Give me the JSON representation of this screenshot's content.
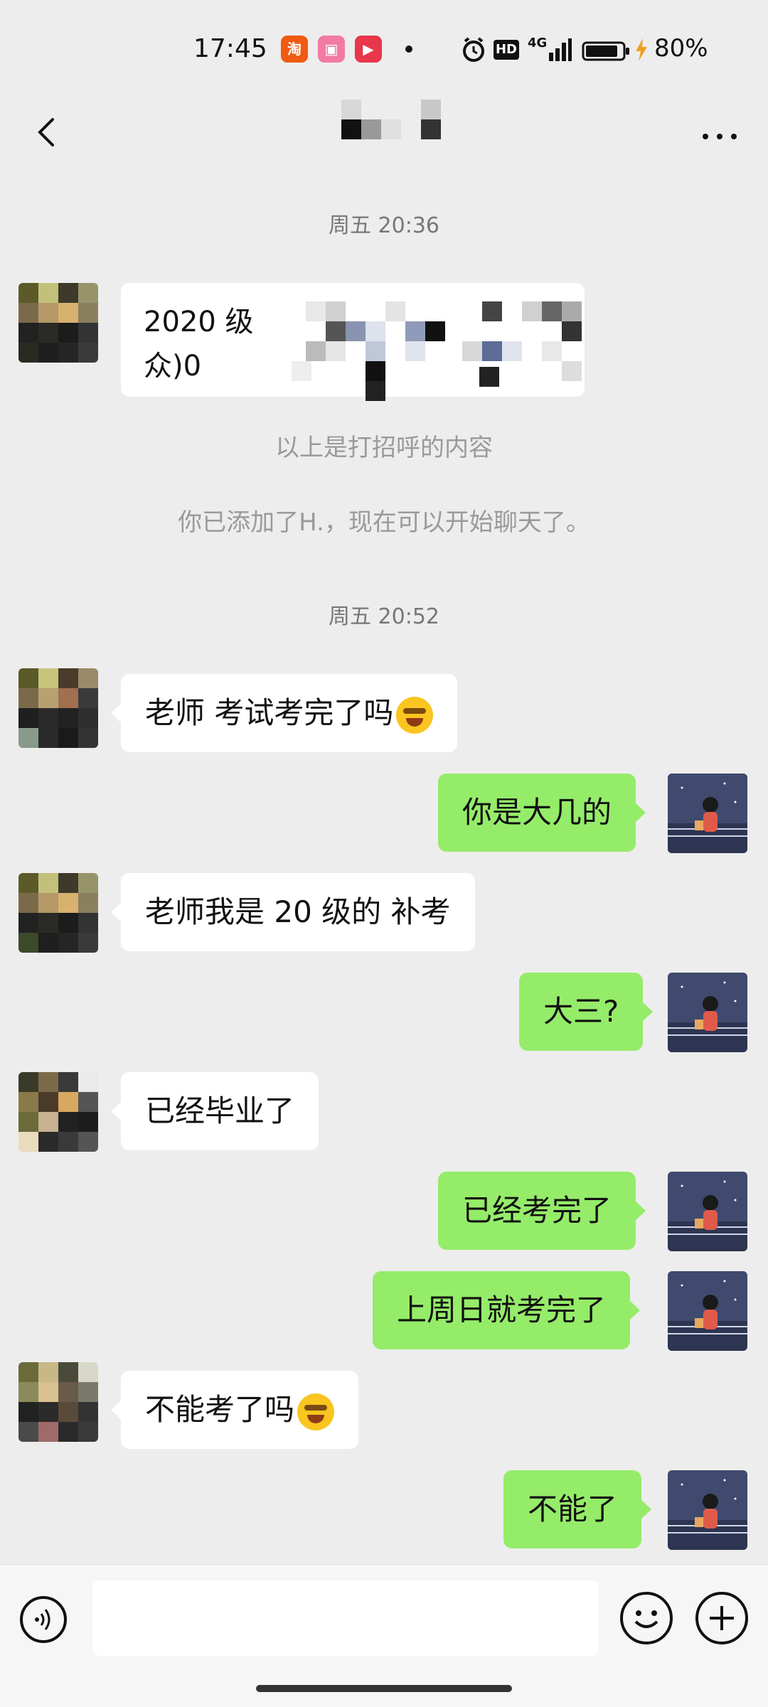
{
  "status_bar": {
    "time": "17:45",
    "apps": [
      "taobao-app-icon",
      "bilibili-app-icon",
      "video-app-icon"
    ],
    "network": "4G",
    "hd": "HD",
    "battery": "80%"
  },
  "nav": {
    "title": "",
    "back_icon": "chevron-left-icon",
    "more_icon": "more-icon"
  },
  "chat": {
    "timestamp_1": "周五 20:36",
    "greeting_text_line1": "2020 级",
    "greeting_text_line2": "众)0",
    "sys_note_1": "以上是打招呼的内容",
    "sys_note_2": "你已添加了H.，现在可以开始聊天了。",
    "timestamp_2": "周五 20:52",
    "messages": [
      {
        "side": "in",
        "text": "老师 考试考完了吗"
      },
      {
        "side": "out",
        "text": "你是大几的"
      },
      {
        "side": "in",
        "text": "老师我是 20 级的 补考"
      },
      {
        "side": "out",
        "text": "大三?"
      },
      {
        "side": "in",
        "text": "已经毕业了"
      },
      {
        "side": "out",
        "text": "已经考完了"
      },
      {
        "side": "out",
        "text": "上周日就考完了"
      },
      {
        "side": "in",
        "text": "不能考了吗"
      },
      {
        "side": "out",
        "text": "不能了"
      }
    ]
  },
  "input": {
    "value": "",
    "voice_icon": "voice-icon",
    "emoji_icon": "emoji-icon",
    "plus_icon": "plus-icon"
  },
  "colors": {
    "background": "#ededed",
    "outgoing_bubble": "#95ec69",
    "incoming_bubble": "#ffffff"
  }
}
